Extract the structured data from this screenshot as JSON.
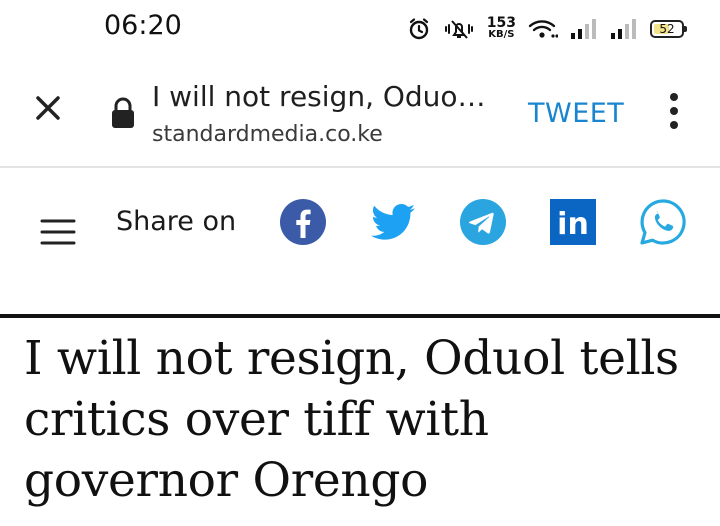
{
  "status_bar": {
    "time": "06:20",
    "net_speed_value": "153",
    "net_speed_unit": "KB/S",
    "battery_level": "52",
    "icons": [
      "alarm-icon",
      "vibrate-icon",
      "wifi-icon",
      "signal-icon",
      "signal-icon",
      "battery-icon"
    ]
  },
  "toolbar": {
    "title": "I will not resign, Oduo…",
    "url": "standardmedia.co.ke",
    "tweet_label": "TWEET",
    "icons": [
      "close-icon",
      "lock-icon",
      "more-vertical-icon"
    ]
  },
  "share": {
    "label": "Share on",
    "icons": [
      "menu-icon",
      "facebook-icon",
      "twitter-icon",
      "telegram-icon",
      "linkedin-icon",
      "whatsapp-icon"
    ],
    "linkedin_text": "in"
  },
  "article": {
    "headline": "I will not resign, Oduol tells critics over tiff with governor Orengo"
  },
  "colors": {
    "facebook": "#3b5ba8",
    "twitter": "#1da1f2",
    "telegram": "#2aa5df",
    "linkedin": "#0a66c2",
    "whatsapp": "#25a9e0",
    "tweet_accent": "#1a85cf"
  }
}
